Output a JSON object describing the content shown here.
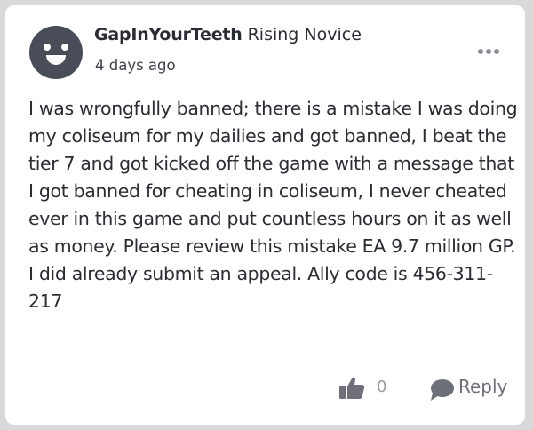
{
  "post": {
    "author": {
      "username": "GapInYourTeeth",
      "rank": "Rising Novice",
      "avatar_icon": "smiley-avatar-icon"
    },
    "time_ago": "4 days ago",
    "body": "I was wrongfully banned; there is a mistake I was doing my coliseum for my dailies and got banned, I beat the tier 7 and got kicked off the game with a message that I got banned for cheating in coliseum, I never cheated ever in this game and put countless hours on it as well as money. Please review this mistake EA 9.7 million GP. I did already submit an appeal. Ally code is 456-311-217",
    "actions": {
      "like_icon": "thumbs-up-icon",
      "like_count": "0",
      "reply_icon": "speech-bubble-icon",
      "reply_label": "Reply"
    },
    "menu_icon": "more-options-icon"
  },
  "colors": {
    "background": "#d9d9db",
    "card": "#ffffff",
    "avatar": "#494d57",
    "text_primary": "#2b2d33",
    "text_muted": "#9a9ca3",
    "icon": "#6d7078"
  }
}
